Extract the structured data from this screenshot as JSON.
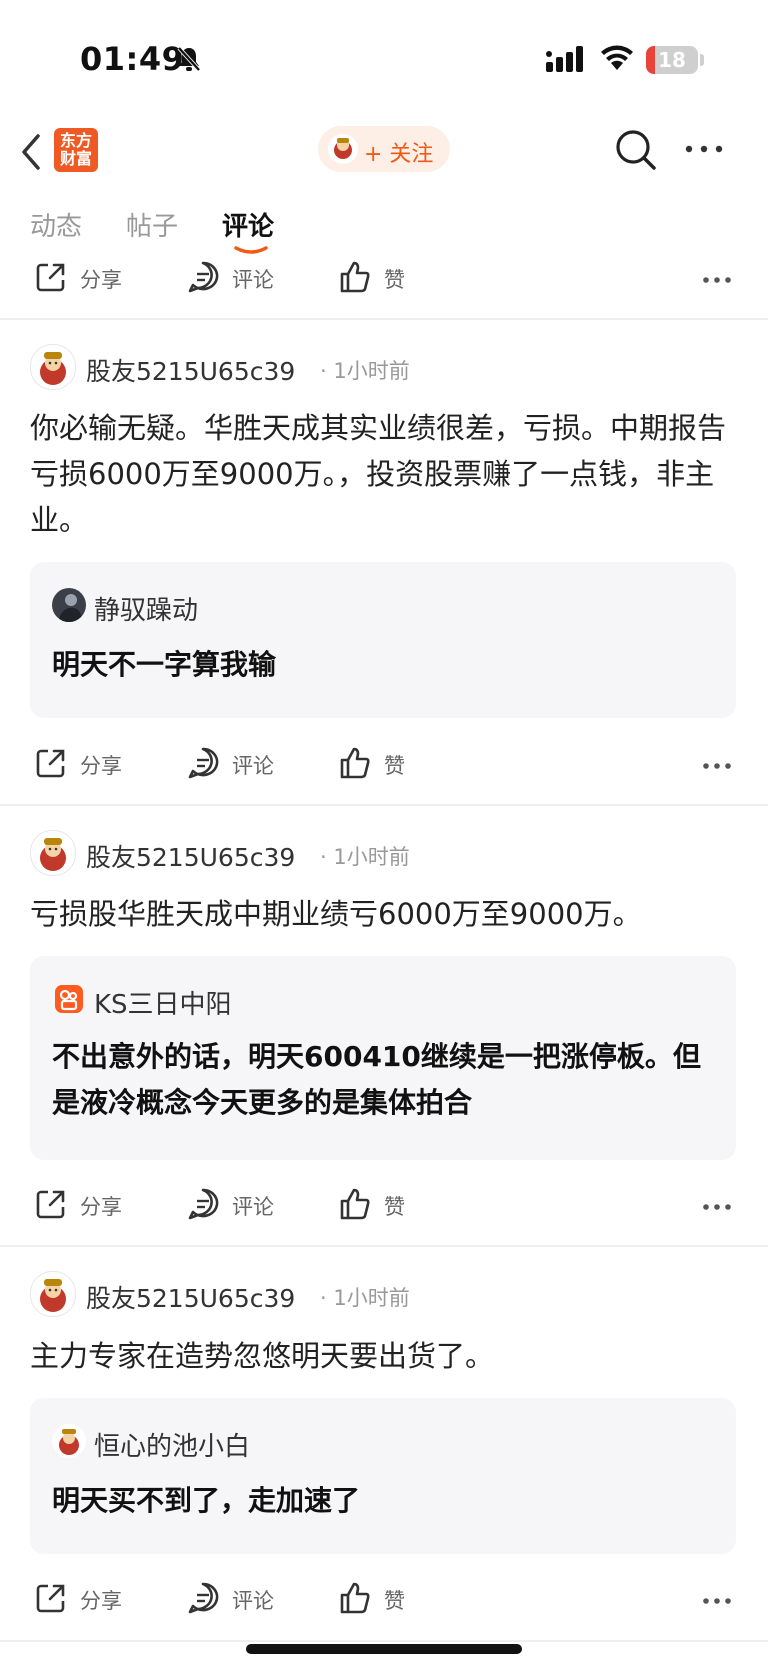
{
  "status_bar": {
    "time": "01:49",
    "battery": "18",
    "battery_level": 0.18
  },
  "nav": {
    "logo_line1": "东方",
    "logo_line2": "财富",
    "follow_label": "+ 关注"
  },
  "tabs": [
    {
      "label": "动态"
    },
    {
      "label": "帖子"
    },
    {
      "label": "评论"
    }
  ],
  "actions": {
    "share": "分享",
    "comment": "评论",
    "like": "赞"
  },
  "posts": [
    {
      "user": "股友5215U65c39",
      "time": "· 1小时前",
      "content": "你必输无疑。华胜天成其实业绩很差，亏损。中期报告亏损6000万至9000万。，投资股票赚了一点钱，非主业。",
      "quote": {
        "user": "静驭躁动",
        "text": "明天不一字算我输"
      }
    },
    {
      "user": "股友5215U65c39",
      "time": "· 1小时前",
      "content": "亏损股华胜天成中期业绩亏6000万至9000万。",
      "quote": {
        "user": "KS三日中阳",
        "text": "不出意外的话，明天600410继续是一把涨停板。但是液冷概念今天更多的是集体拍合"
      }
    },
    {
      "user": "股友5215U65c39",
      "time": "· 1小时前",
      "content": "主力专家在造势忽悠明天要出货了。",
      "quote": {
        "user": "恒心的池小白",
        "text": "明天买不到了，走加速了"
      }
    }
  ]
}
